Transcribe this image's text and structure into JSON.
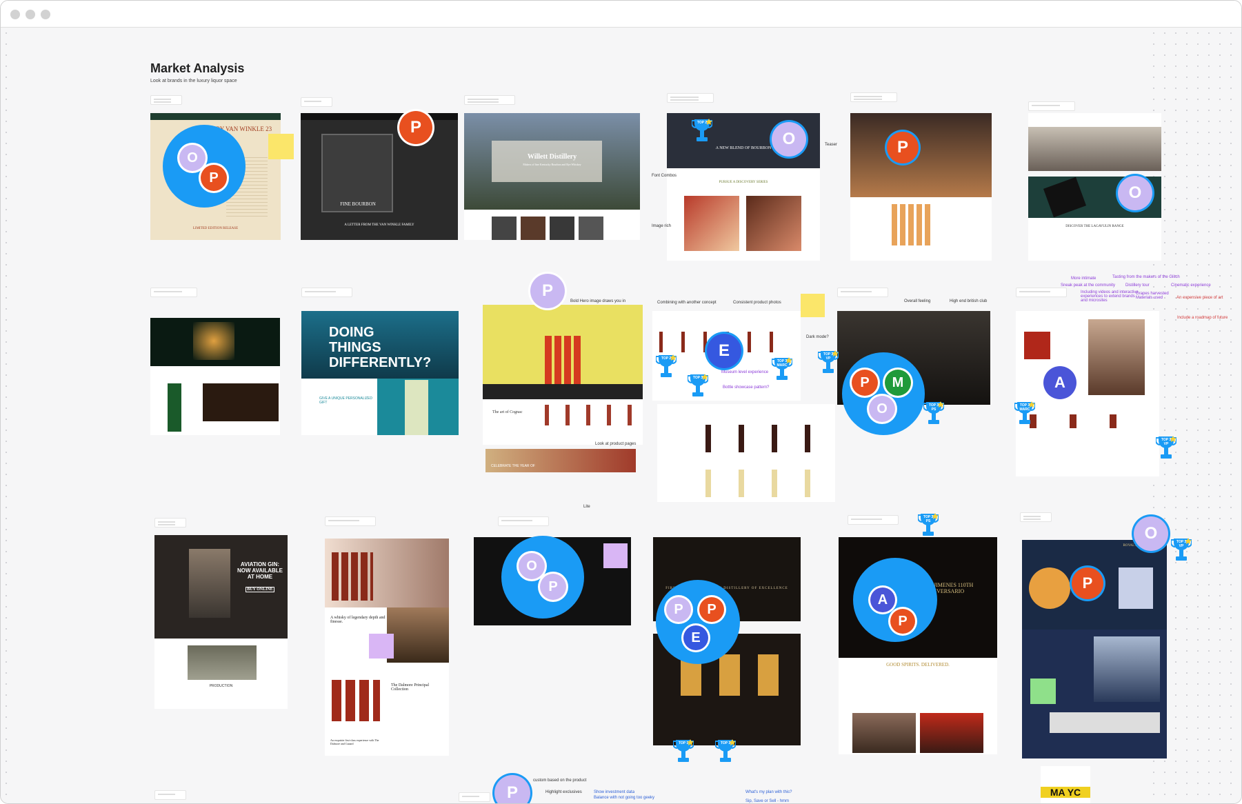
{
  "window": {
    "title": ""
  },
  "board": {
    "title": "Market Analysis",
    "subtitle": "Look at brands in the luxury liquor space"
  },
  "annotations": {
    "teaser": "Teaser",
    "font_combos": "Font Combos",
    "image_rich": "Image rich",
    "bold_hero": "Bold Hero image draws you in",
    "combining": "Combining with another concept",
    "consistent": "Consistent product photos",
    "dark_mode": "Dark mode?",
    "museum": "Museum level experience",
    "bottle_showcase": "Bottle showcase pattern?",
    "overall_feeling": "Overall feeling",
    "high_end_club": "High end british club",
    "look_at_product": "Look at product pages",
    "more_intimate": "More intimate",
    "sneak_peak": "Sneak peak at the community",
    "tasting": "Tasting from the makers of the Glitch",
    "distillery_tour": "Distillery tour",
    "cinematic": "Cinematic experience",
    "videos": "Including videos and interactive experiences to extend brands and microsites",
    "grapes": "Grapes harvested Materials used",
    "expensive": "An expensive piece of art",
    "roadmap": "Include a roadmap of future",
    "custom": "custom based on the product",
    "highlight": "Highlight exclusives",
    "investment": "Show investment data",
    "balance": "Balance with not going too geeky",
    "plan": "What's my plan with this?",
    "sip": "Sip, Save or Sell - hmm",
    "lite": "Lite"
  },
  "shots": {
    "pappy": "PAPPY VAN WINKLE 23 YEAR",
    "pappy_foot": "LIMITED EDITION RELEASE",
    "fine_bourbon": "FINE BOURBON",
    "letter": "A LETTER FROM THE VAN WINKLE FAMILY",
    "willett": "Willett Distillery",
    "willett_sub": "Makers of fine Kentucky Bourbon and Rye Whiskey",
    "new_blend": "A NEW BLEND OF BOURBON",
    "discovery": "PURSUE A DISCOVERY SERIES",
    "lagavulin": "DISCOVER THE LAGAVULIN RANGE",
    "doing": "DOING THINGS DIFFERENTLY?",
    "give_unique": "GIVE A UNIQUE PERSONALIZED GIFT",
    "art_cognac": "The art of Cognac",
    "celebrate": "CELEBRATE THE YEAR OF",
    "aviation": "AVIATION GIN: NOW AVAILABLE AT HOME",
    "buy_online": "BUY ONLINE",
    "production": "PRODUCTION",
    "legendary": "A whisky of legendary depth and finesse.",
    "principal": "The Dalmore Principal Collection",
    "exquisite": "An exquisite first-class experience with The Dalmore and Cunard",
    "first_class": "FIRST CLASS PORT SINCE DISTILLERY OF EXCELLENCE",
    "leon": "LEÓN JIMENES 110TH ANIVERSARIO",
    "good_spirits": "GOOD SPIRITS. DELIVERED.",
    "royal": "ROYAL SALUTE",
    "mayc": "MA YC"
  },
  "trophies": [
    "TOP 2",
    "TOP 2",
    "TOP 3",
    "TOP 3 VP",
    "TOP 3 MARC",
    "TOP 3 PS",
    "TOP 3 MARC",
    "TOP 3 VP",
    "TOP 3 PS",
    "TOP 3 VP",
    "TOP 1",
    "TOP 3"
  ],
  "avatars": {
    "P": "P",
    "O": "O",
    "A": "A",
    "M": "M",
    "E": "E"
  },
  "colors": {
    "bubble": "#1a9bf5",
    "P": "#e8501f",
    "O": "#c9b8f2",
    "A": "#4a55d8",
    "M": "#1f9a3a",
    "E": "#3558e0",
    "sticky_yellow": "#fbe66a",
    "sticky_purple": "#d9b6f5",
    "sticky_green": "#8fe08a"
  }
}
